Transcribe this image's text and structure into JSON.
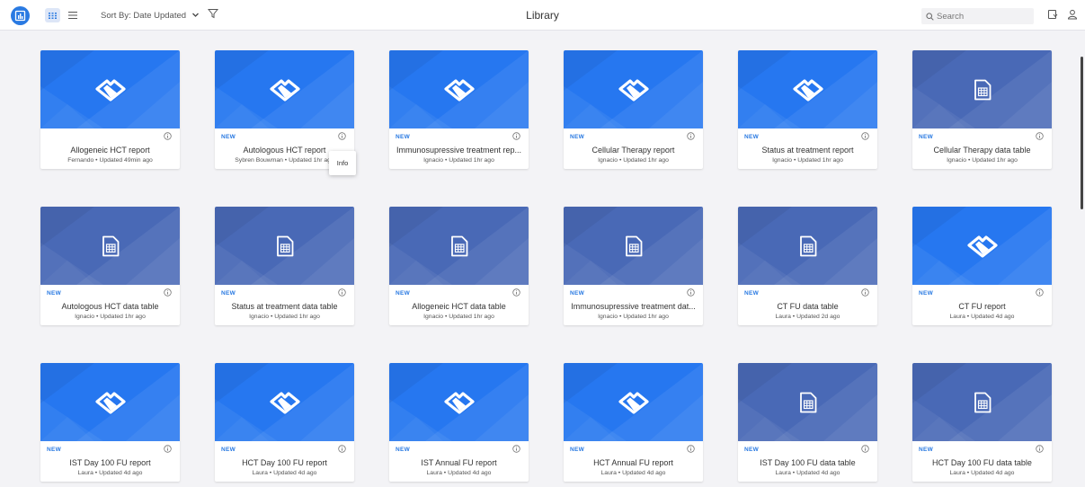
{
  "header": {
    "title": "Library",
    "sort_label": "Sort By: Date Updated",
    "search_placeholder": "Search"
  },
  "tooltip": {
    "text": "Info"
  },
  "colors": {
    "accent": "#2a7ae2",
    "report_bg": "#2677f0",
    "table_bg": "#4969b6"
  },
  "cards": [
    {
      "type": "report",
      "is_new": false,
      "new_label": "",
      "name": "Allogeneic HCT report",
      "subtitle": "Fernando • Updated 49min ago"
    },
    {
      "type": "report",
      "is_new": true,
      "new_label": "NEW",
      "name": "Autologous HCT report",
      "subtitle": "Sybren Bouwman • Updated 1hr ago"
    },
    {
      "type": "report",
      "is_new": true,
      "new_label": "NEW",
      "name": "Immunosupressive treatment rep...",
      "subtitle": "Ignacio • Updated 1hr ago"
    },
    {
      "type": "report",
      "is_new": true,
      "new_label": "NEW",
      "name": "Cellular Therapy report",
      "subtitle": "Ignacio • Updated 1hr ago"
    },
    {
      "type": "report",
      "is_new": true,
      "new_label": "NEW",
      "name": "Status at treatment report",
      "subtitle": "Ignacio • Updated 1hr ago"
    },
    {
      "type": "table",
      "is_new": true,
      "new_label": "NEW",
      "name": "Cellular Therapy data table",
      "subtitle": "Ignacio • Updated 1hr ago"
    },
    {
      "type": "table",
      "is_new": true,
      "new_label": "NEW",
      "name": "Autologous HCT data table",
      "subtitle": "Ignacio • Updated 1hr ago"
    },
    {
      "type": "table",
      "is_new": true,
      "new_label": "NEW",
      "name": "Status at treatment data table",
      "subtitle": "Ignacio • Updated 1hr ago"
    },
    {
      "type": "table",
      "is_new": true,
      "new_label": "NEW",
      "name": "Allogeneic HCT data table",
      "subtitle": "Ignacio • Updated 1hr ago"
    },
    {
      "type": "table",
      "is_new": true,
      "new_label": "NEW",
      "name": "Immunosupressive treatment dat...",
      "subtitle": "Ignacio • Updated 1hr ago"
    },
    {
      "type": "table",
      "is_new": true,
      "new_label": "NEW",
      "name": "CT FU data table",
      "subtitle": "Laura • Updated 2d ago"
    },
    {
      "type": "report",
      "is_new": true,
      "new_label": "NEW",
      "name": "CT FU report",
      "subtitle": "Laura • Updated 4d ago"
    },
    {
      "type": "report",
      "is_new": true,
      "new_label": "NEW",
      "name": "IST Day 100 FU report",
      "subtitle": "Laura • Updated 4d ago"
    },
    {
      "type": "report",
      "is_new": true,
      "new_label": "NEW",
      "name": "HCT Day 100 FU report",
      "subtitle": "Laura • Updated 4d ago"
    },
    {
      "type": "report",
      "is_new": true,
      "new_label": "NEW",
      "name": "IST Annual FU report",
      "subtitle": "Laura • Updated 4d ago"
    },
    {
      "type": "report",
      "is_new": true,
      "new_label": "NEW",
      "name": "HCT Annual FU report",
      "subtitle": "Laura • Updated 4d ago"
    },
    {
      "type": "table",
      "is_new": true,
      "new_label": "NEW",
      "name": "IST Day 100 FU data table",
      "subtitle": "Laura • Updated 4d ago"
    },
    {
      "type": "table",
      "is_new": true,
      "new_label": "NEW",
      "name": "HCT Day 100 FU data table",
      "subtitle": "Laura • Updated 4d ago"
    }
  ]
}
